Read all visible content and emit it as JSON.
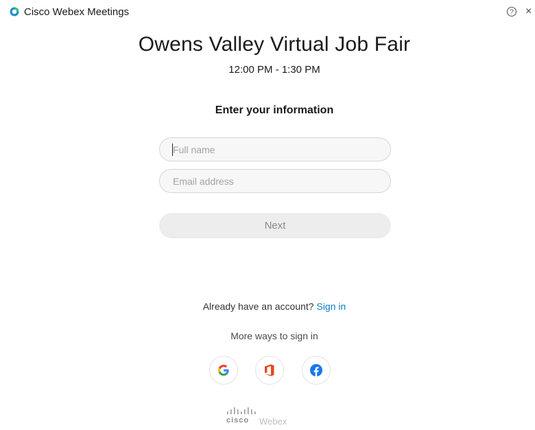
{
  "app": {
    "title": "Cisco Webex Meetings",
    "logo_icon": "webex-logo-icon",
    "help_icon": "help-circle-icon",
    "close_glyph": "×",
    "accent_color": "#0a7fcf"
  },
  "meeting": {
    "title": "Owens Valley Virtual Job Fair",
    "time": "12:00 PM - 1:30 PM"
  },
  "form": {
    "heading": "Enter your information",
    "full_name": {
      "value": "",
      "placeholder": "Full name"
    },
    "email": {
      "value": "",
      "placeholder": "Email address"
    },
    "next_label": "Next"
  },
  "signin": {
    "prompt": "Already have an account?",
    "link_label": "Sign in",
    "more_ways": "More ways to sign in",
    "providers": [
      {
        "name": "Google",
        "icon": "google-icon"
      },
      {
        "name": "Office",
        "icon": "office-icon"
      },
      {
        "name": "Facebook",
        "icon": "facebook-icon"
      }
    ]
  },
  "footer": {
    "brand_cisco": "cisco",
    "brand_webex": "Webex"
  }
}
